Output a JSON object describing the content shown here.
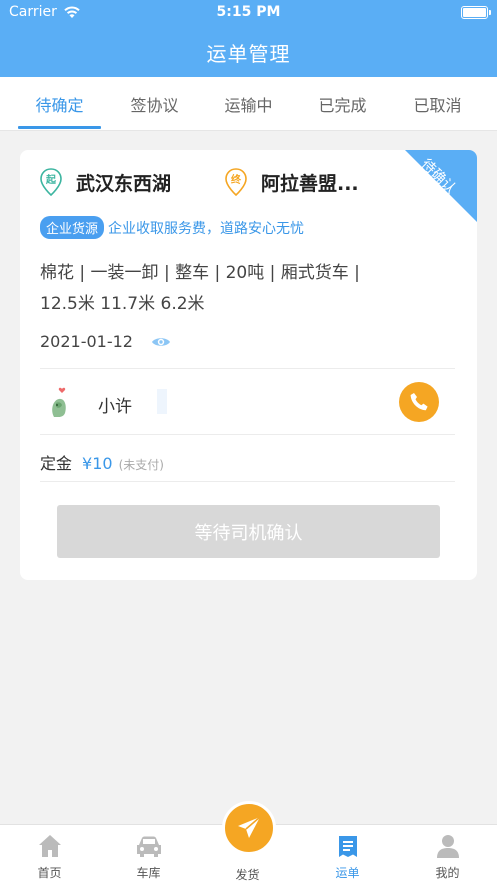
{
  "status": {
    "carrier": "Carrier",
    "time": "5:15 PM"
  },
  "nav": {
    "title": "运单管理"
  },
  "tabs": [
    "待确定",
    "签协议",
    "运输中",
    "已完成",
    "已取消"
  ],
  "order": {
    "corner_tag": "待确认",
    "start_marker": "起",
    "start": "武汉东西湖",
    "end_marker": "终",
    "end": "阿拉善盟...",
    "badge": "企业货源",
    "badge_note": "企业收取服务费，道路安心无忧",
    "cargo_line1": "棉花 | 一装一卸 | 整车 | 20吨 | 厢式货车 |",
    "cargo_line2": "12.5米 11.7米 6.2米",
    "date": "2021-01-12",
    "driver_name": "小许",
    "deposit_label": "定金",
    "deposit_amount": "¥10",
    "deposit_status": "(未支付)",
    "action": "等待司机确认"
  },
  "tabbar": [
    {
      "label": "首页",
      "icon": "home-icon"
    },
    {
      "label": "车库",
      "icon": "car-icon"
    },
    {
      "label": "发货",
      "icon": "paper-plane-icon"
    },
    {
      "label": "运单",
      "icon": "waybill-icon",
      "active": true
    },
    {
      "label": "我的",
      "icon": "user-icon"
    }
  ],
  "colors": {
    "primary": "#5aaef5",
    "accent": "#3a97e8",
    "orange": "#f5a623",
    "start_pin": "#3cb5a0"
  }
}
